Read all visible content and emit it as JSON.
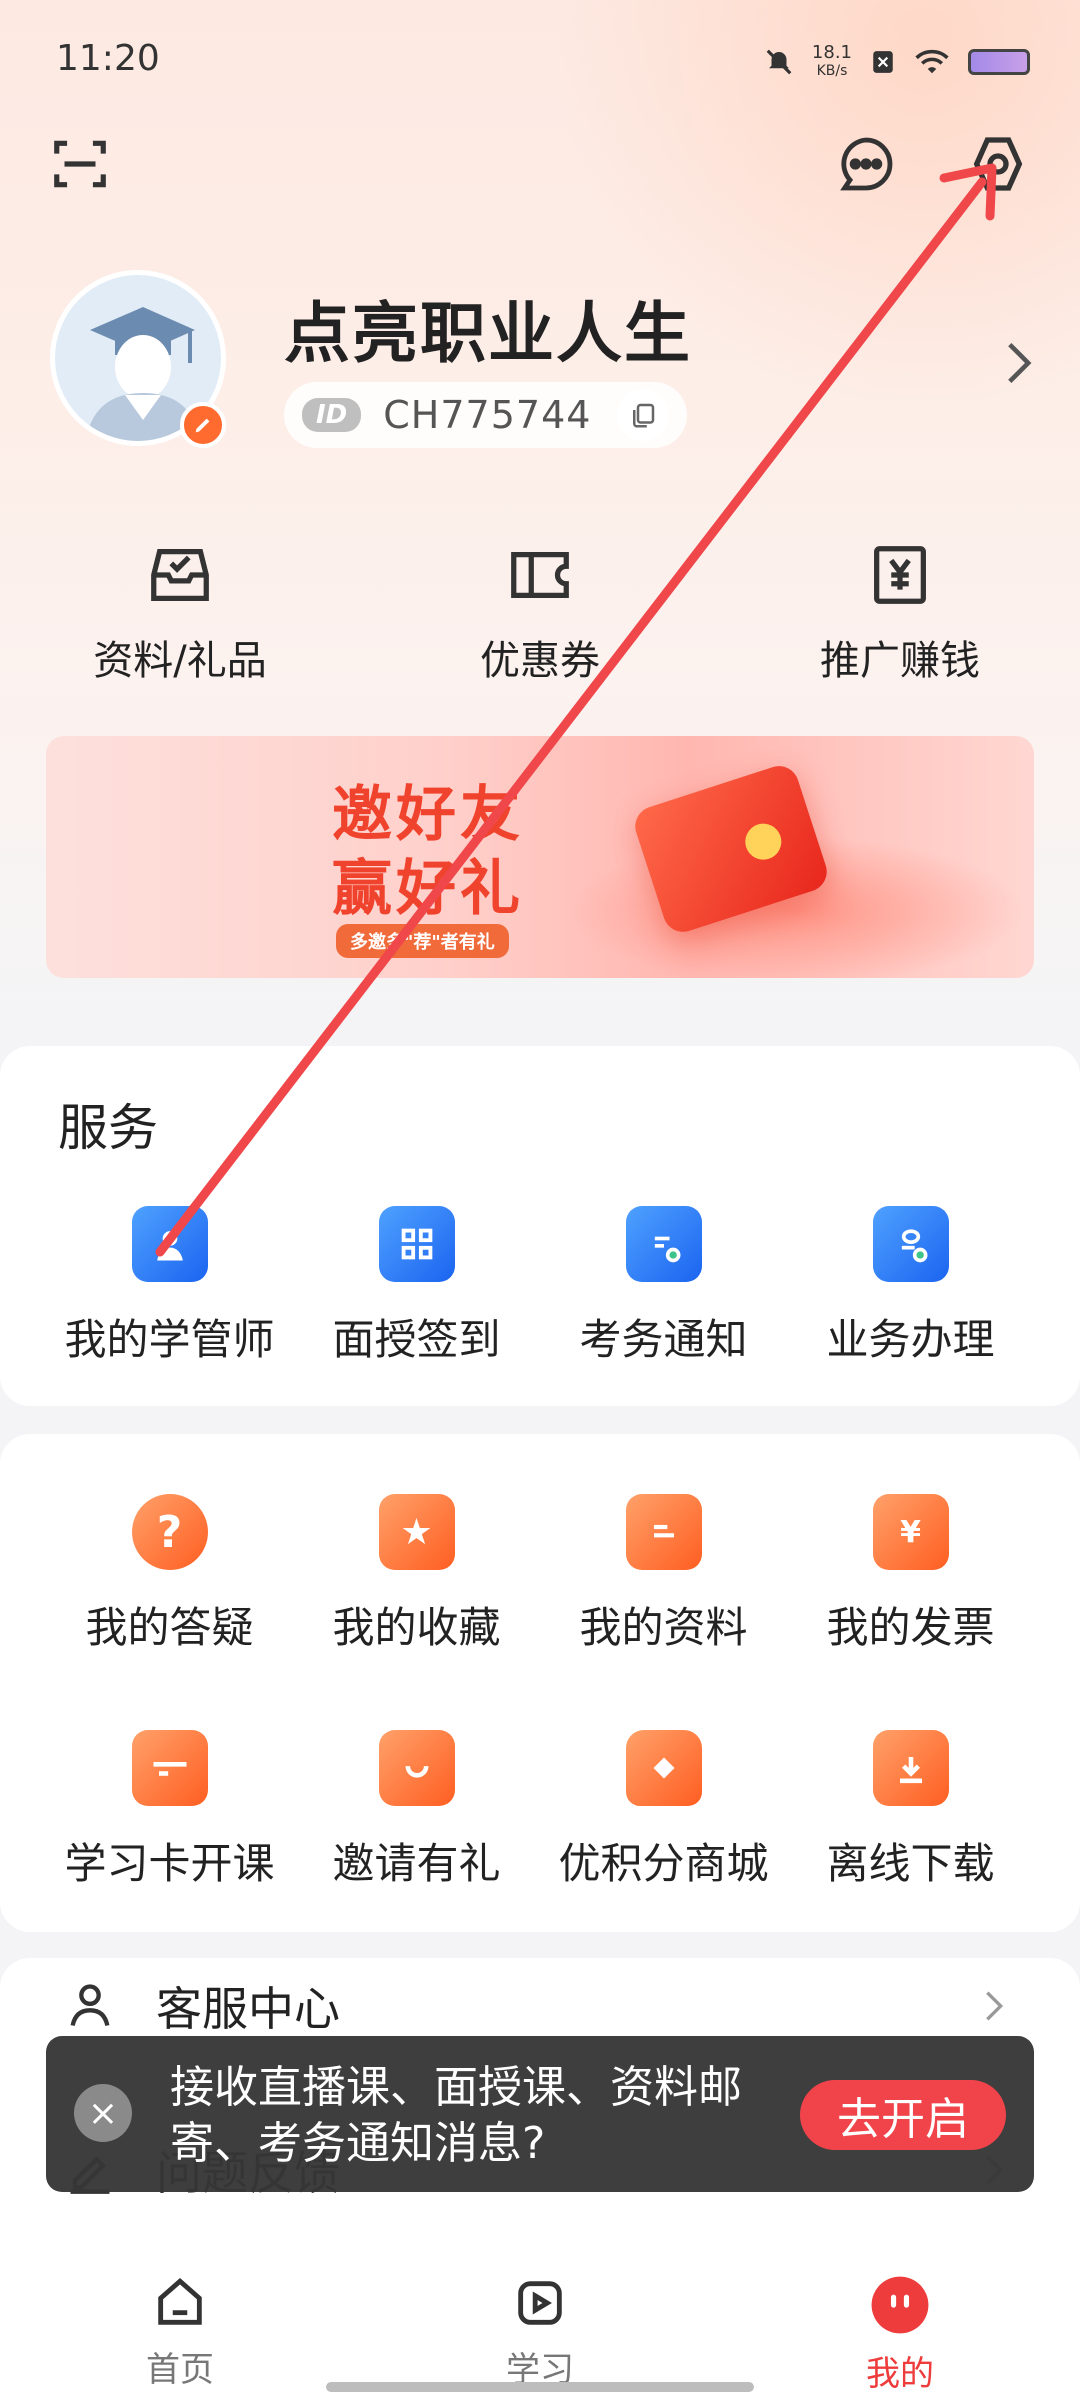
{
  "status": {
    "time": "11:20",
    "net_speed": "18.1",
    "net_unit": "KB/s"
  },
  "profile": {
    "name": "点亮职业人生",
    "id_badge": "ID",
    "id": "CH775744"
  },
  "quick_actions": [
    {
      "label": "资料/礼品",
      "icon": "inbox-check-icon"
    },
    {
      "label": "优惠券",
      "icon": "ticket-icon"
    },
    {
      "label": "推广赚钱",
      "icon": "yuan-doc-icon"
    }
  ],
  "banner": {
    "line1": "邀好友",
    "line2": "赢好礼",
    "tagline": "多邀多\"荐\"者有礼"
  },
  "services": {
    "title": "服务",
    "items": [
      {
        "label": "我的学管师",
        "icon": "teacher-icon"
      },
      {
        "label": "面授签到",
        "icon": "qr-scan-icon"
      },
      {
        "label": "考务通知",
        "icon": "clipboard-bell-icon"
      },
      {
        "label": "业务办理",
        "icon": "doc-user-icon"
      }
    ]
  },
  "tools": {
    "row1": [
      {
        "label": "我的答疑",
        "icon": "question-bubble-icon"
      },
      {
        "label": "我的收藏",
        "icon": "folder-star-icon"
      },
      {
        "label": "我的资料",
        "icon": "document-icon"
      },
      {
        "label": "我的发票",
        "icon": "invoice-icon"
      }
    ],
    "row2": [
      {
        "label": "学习卡开课",
        "icon": "card-icon"
      },
      {
        "label": "邀请有礼",
        "icon": "gift-basket-icon"
      },
      {
        "label": "优积分商城",
        "icon": "shopping-bag-icon"
      },
      {
        "label": "离线下载",
        "icon": "download-icon"
      }
    ]
  },
  "menu": {
    "customer_service": "客服中心",
    "feedback": "问题反馈"
  },
  "toast": {
    "message": "接收直播课、面授课、资料邮寄、考务通知消息?",
    "action": "去开启"
  },
  "nav": {
    "home": "首页",
    "study": "学习",
    "mine": "我的"
  },
  "colors": {
    "accent": "#ee3b3b",
    "orange": "#ff6a2e",
    "blue": "#1b64f0"
  }
}
